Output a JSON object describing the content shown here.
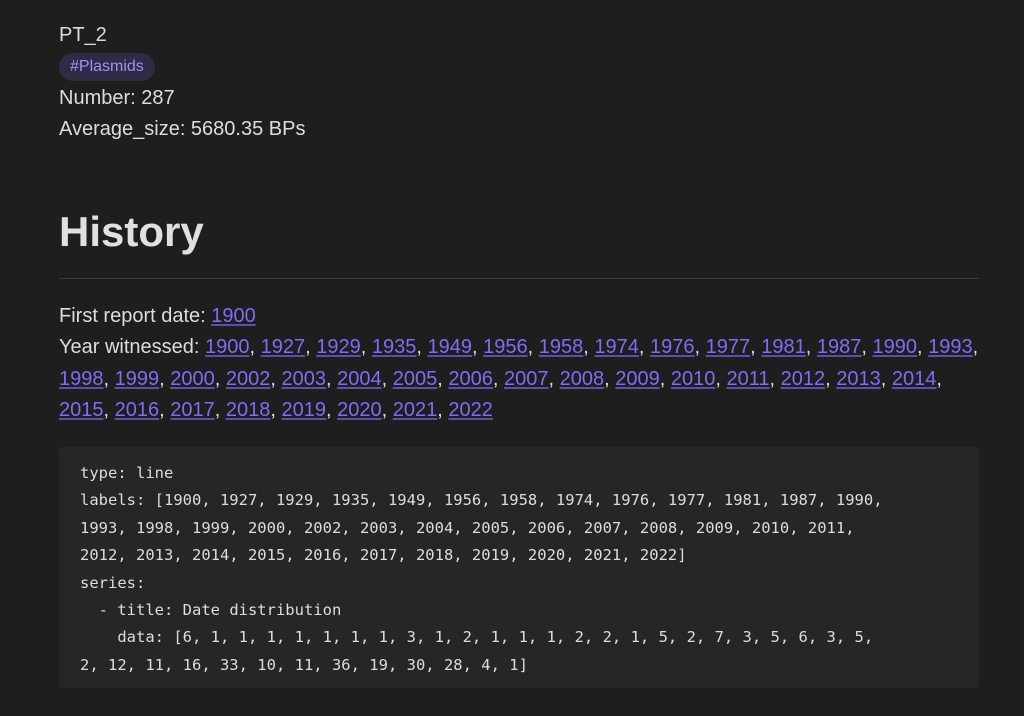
{
  "note": {
    "title": "PT_2",
    "tag": "#Plasmids",
    "number_line": "Number: 287",
    "average_size_line": "Average_size: 5680.35 BPs"
  },
  "history": {
    "heading": "History",
    "first_report_label": "First report date:",
    "first_report_year": "1900",
    "years_label": "Year witnessed:",
    "years": [
      "1900",
      "1927",
      "1929",
      "1935",
      "1949",
      "1956",
      "1958",
      "1974",
      "1976",
      "1977",
      "1981",
      "1987",
      "1990",
      "1993",
      "1998",
      "1999",
      "2000",
      "2002",
      "2003",
      "2004",
      "2005",
      "2006",
      "2007",
      "2008",
      "2009",
      "2010",
      "2011",
      "2012",
      "2013",
      "2014",
      "2015",
      "2016",
      "2017",
      "2018",
      "2019",
      "2020",
      "2021",
      "2022"
    ]
  },
  "code": {
    "lines": [
      "type: line",
      "labels: [1900, 1927, 1929, 1935, 1949, 1956, 1958, 1974, 1976, 1977, 1981, 1987, 1990,",
      "1993, 1998, 1999, 2000, 2002, 2003, 2004, 2005, 2006, 2007, 2008, 2009, 2010, 2011,",
      "2012, 2013, 2014, 2015, 2016, 2017, 2018, 2019, 2020, 2021, 2022]",
      "series:",
      "  - title: Date distribution",
      "    data: [6, 1, 1, 1, 1, 1, 1, 1, 3, 1, 2, 1, 1, 1, 2, 2, 1, 5, 2, 7, 3, 5, 6, 3, 5,",
      "2, 12, 11, 16, 33, 10, 11, 36, 19, 30, 28, 4, 1]"
    ]
  }
}
